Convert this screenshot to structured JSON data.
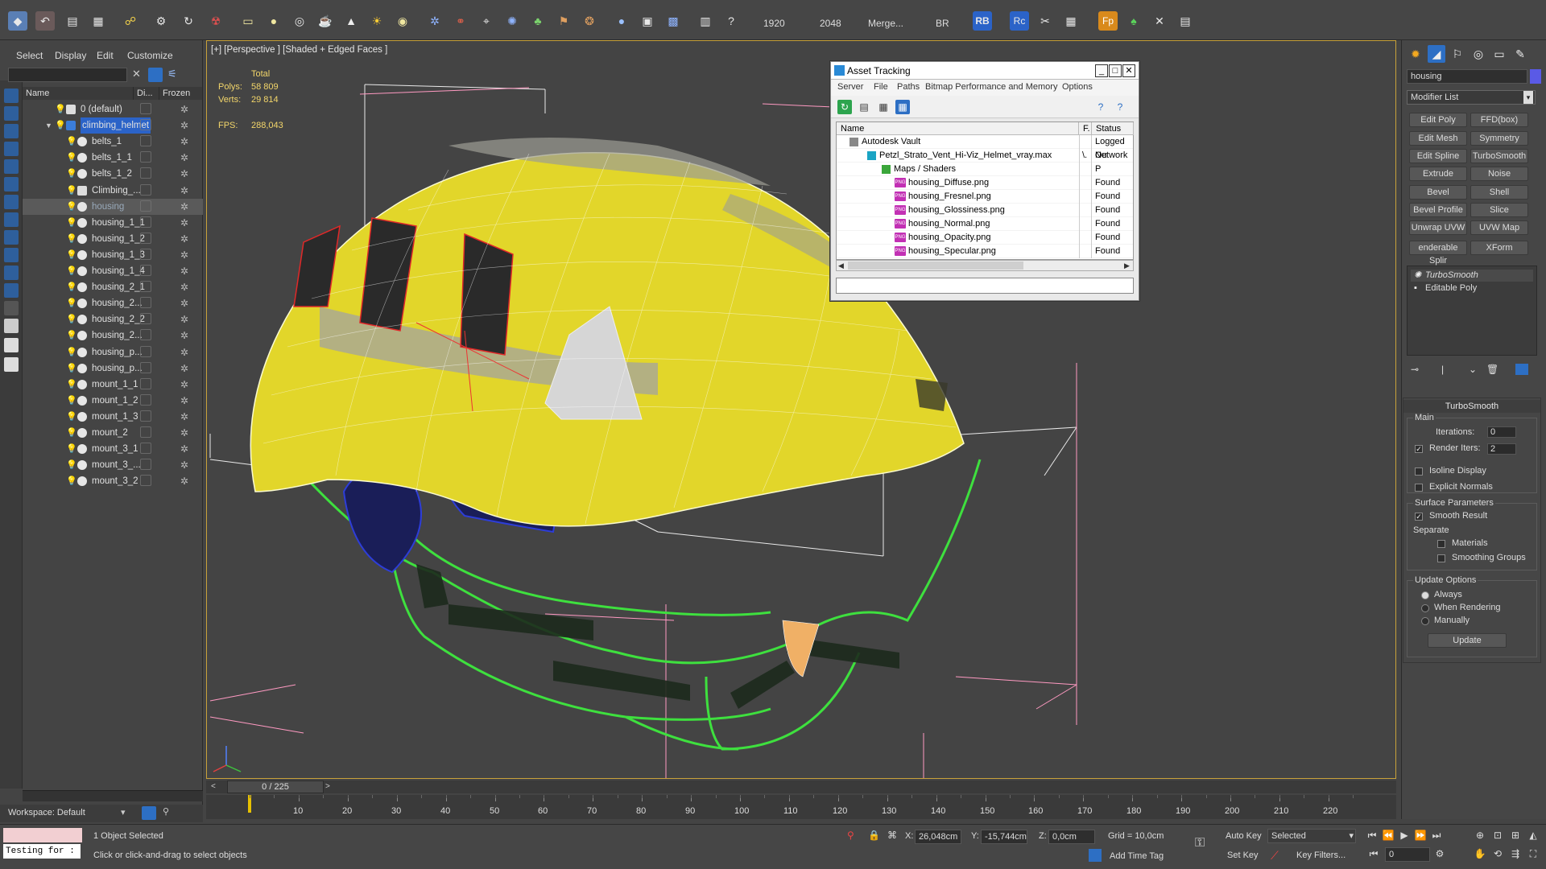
{
  "toolbar": {
    "render_width": "1920",
    "render_height": "2048",
    "merge_label": "Merge...",
    "br_label": "BR",
    "rb_label": "RB",
    "rc_label": "Rc",
    "fp_label": "Fp"
  },
  "explorer": {
    "menu": [
      "Select",
      "Display",
      "Edit",
      "Customize"
    ],
    "columns": {
      "name": "Name",
      "display": "Di...",
      "frozen": "Frozen"
    },
    "items": [
      {
        "label": "0 (default)"
      },
      {
        "label": "climbing_helmet"
      },
      {
        "label": "belts_1"
      },
      {
        "label": "belts_1_1"
      },
      {
        "label": "belts_1_2"
      },
      {
        "label": "Climbing_..."
      },
      {
        "label": "housing"
      },
      {
        "label": "housing_1_1"
      },
      {
        "label": "housing_1_2"
      },
      {
        "label": "housing_1_3"
      },
      {
        "label": "housing_1_4"
      },
      {
        "label": "housing_2_1"
      },
      {
        "label": "housing_2..."
      },
      {
        "label": "housing_2_2"
      },
      {
        "label": "housing_2..."
      },
      {
        "label": "housing_p..."
      },
      {
        "label": "housing_p..."
      },
      {
        "label": "mount_1_1"
      },
      {
        "label": "mount_1_2"
      },
      {
        "label": "mount_1_3"
      },
      {
        "label": "mount_2"
      },
      {
        "label": "mount_3_1"
      },
      {
        "label": "mount_3_..."
      },
      {
        "label": "mount_3_2"
      }
    ],
    "workspace": "Workspace: Default"
  },
  "viewport": {
    "label": "[+] [Perspective ] [Shaded + Edged Faces ]",
    "stats_total": "Total",
    "polys_label": "Polys:",
    "polys_value": "58 809",
    "verts_label": "Verts:",
    "verts_value": "29 814",
    "fps_label": "FPS:",
    "fps_value": "288,043"
  },
  "asset_tracking": {
    "title": "Asset Tracking",
    "menu": [
      "Server",
      "File",
      "Paths",
      "Bitmap Performance and Memory",
      "Options"
    ],
    "columns": {
      "name": "Name",
      "f": "F.",
      "status": "Status"
    },
    "rows": [
      {
        "name": "Autodesk Vault",
        "f": "",
        "status": "Logged Ou"
      },
      {
        "name": "Petzl_Strato_Vent_Hi-Viz_Helmet_vray.max",
        "f": "\\.",
        "status": "Network P"
      },
      {
        "name": "Maps / Shaders",
        "f": "",
        "status": ""
      },
      {
        "name": "housing_Diffuse.png",
        "f": "",
        "status": "Found"
      },
      {
        "name": "housing_Fresnel.png",
        "f": "",
        "status": "Found"
      },
      {
        "name": "housing_Glossiness.png",
        "f": "",
        "status": "Found"
      },
      {
        "name": "housing_Normal.png",
        "f": "",
        "status": "Found"
      },
      {
        "name": "housing_Opacity.png",
        "f": "",
        "status": "Found"
      },
      {
        "name": "housing_Specular.png",
        "f": "",
        "status": "Found"
      }
    ],
    "png_tag": "PNG"
  },
  "command_panel": {
    "object_name": "housing",
    "object_color": "#5a5ae6",
    "modifier_list": "Modifier List",
    "modifier_buttons": [
      "Edit Poly",
      "FFD(box)",
      "Edit Mesh",
      "Symmetry",
      "Edit Spline",
      "TurboSmooth",
      "Extrude",
      "Noise",
      "Bevel",
      "Shell",
      "Bevel Profile",
      "Slice",
      "Unwrap UVW",
      "UVW Map",
      "enderable Splir",
      "XForm"
    ],
    "stack": [
      "TurboSmooth",
      "Editable Poly"
    ],
    "rollout_title": "TurboSmooth",
    "main_group": "Main",
    "iterations_label": "Iterations:",
    "iterations_value": "0",
    "render_iters_label": "Render Iters:",
    "render_iters_value": "2",
    "isoline_label": "Isoline Display",
    "explicit_label": "Explicit Normals",
    "surface_group": "Surface Parameters",
    "smooth_result_label": "Smooth Result",
    "separate_label": "Separate",
    "materials_label": "Materials",
    "smoothing_groups_label": "Smoothing Groups",
    "update_group": "Update Options",
    "always_label": "Always",
    "when_rendering_label": "When Rendering",
    "manually_label": "Manually",
    "update_button": "Update"
  },
  "timeline": {
    "frame_display": "0 / 225",
    "ticks": [
      "10",
      "20",
      "30",
      "40",
      "50",
      "60",
      "70",
      "80",
      "90",
      "100",
      "110",
      "120",
      "130",
      "140",
      "150",
      "160",
      "170",
      "180",
      "190",
      "200",
      "210",
      "220"
    ]
  },
  "statusbar": {
    "maxscript": "Testing for :",
    "selection": "1 Object Selected",
    "prompt": "Click or click-and-drag to select objects",
    "x_label": "X:",
    "x_value": "26,048cm",
    "y_label": "Y:",
    "y_value": "-15,744cm",
    "z_label": "Z:",
    "z_value": "0,0cm",
    "grid": "Grid = 10,0cm",
    "add_time_tag": "Add Time Tag",
    "auto_key": "Auto Key",
    "set_key": "Set Key",
    "selected_dropdown": "Selected",
    "key_filters": "Key Filters...",
    "frame_value": "0"
  }
}
